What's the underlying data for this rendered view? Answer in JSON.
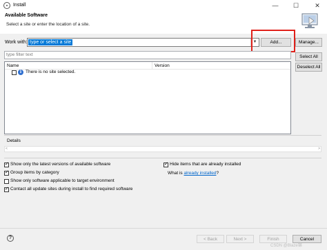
{
  "window": {
    "title": "Install",
    "controls": {
      "minimize": "—",
      "maximize": "☐",
      "close": "✕"
    }
  },
  "banner": {
    "title": "Available Software",
    "subtitle": "Select a site or enter the location of a site."
  },
  "work_with": {
    "label": "Work with:",
    "value": "type or select a site",
    "add_button": "Add...",
    "manage_button": "Manage..."
  },
  "filter": {
    "placeholder": "type filter text"
  },
  "table": {
    "columns": [
      "Name",
      "Version"
    ],
    "message": "There is no site selected."
  },
  "side_buttons": {
    "select_all": "Select All",
    "deselect_all": "Deselect All"
  },
  "details": {
    "label": "Details"
  },
  "options_left": [
    {
      "label": "Show only the latest versions of available software",
      "checked": true
    },
    {
      "label": "Group items by category",
      "checked": true
    },
    {
      "label": "Show only software applicable to target environment",
      "checked": false
    },
    {
      "label": "Contact all update sites during install to find required software",
      "checked": true
    }
  ],
  "options_right": {
    "hide_installed": {
      "label": "Hide items that are already installed",
      "checked": true
    },
    "what_is": "What is",
    "already_installed_link": "already installed",
    "suffix": "?"
  },
  "footer": {
    "back": "< Back",
    "next": "Next >",
    "finish": "Finish",
    "cancel": "Cancel"
  },
  "watermark": "CSDN @Blaze锦",
  "colors": {
    "highlight_box": "#e0201a",
    "selection": "#0078d7",
    "link": "#0066cc"
  }
}
